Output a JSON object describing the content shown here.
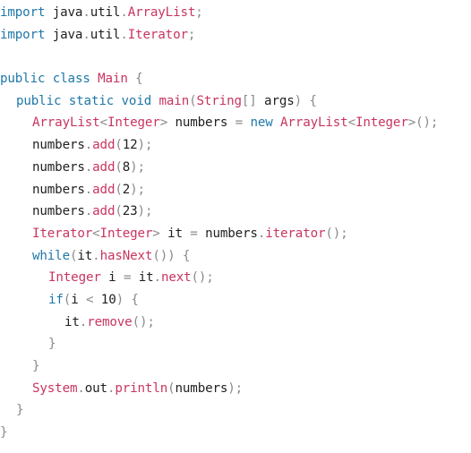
{
  "lines": [
    {
      "indent": 0,
      "tokens": [
        {
          "t": "import",
          "c": "kw"
        },
        {
          "t": " java",
          "c": "tx"
        },
        {
          "t": ".",
          "c": "pn"
        },
        {
          "t": "util",
          "c": "tx"
        },
        {
          "t": ".",
          "c": "pn"
        },
        {
          "t": "ArrayList",
          "c": "ty"
        },
        {
          "t": ";",
          "c": "pn"
        }
      ]
    },
    {
      "indent": 0,
      "tokens": [
        {
          "t": "import",
          "c": "kw"
        },
        {
          "t": " java",
          "c": "tx"
        },
        {
          "t": ".",
          "c": "pn"
        },
        {
          "t": "util",
          "c": "tx"
        },
        {
          "t": ".",
          "c": "pn"
        },
        {
          "t": "Iterator",
          "c": "ty"
        },
        {
          "t": ";",
          "c": "pn"
        }
      ]
    },
    {
      "indent": 0,
      "tokens": []
    },
    {
      "indent": 0,
      "tokens": [
        {
          "t": "public",
          "c": "kw"
        },
        {
          "t": " ",
          "c": "tx"
        },
        {
          "t": "class",
          "c": "kw"
        },
        {
          "t": " ",
          "c": "tx"
        },
        {
          "t": "Main",
          "c": "ty"
        },
        {
          "t": " {",
          "c": "pn"
        }
      ]
    },
    {
      "indent": 1,
      "tokens": [
        {
          "t": "public",
          "c": "kw"
        },
        {
          "t": " ",
          "c": "tx"
        },
        {
          "t": "static",
          "c": "kw"
        },
        {
          "t": " ",
          "c": "tx"
        },
        {
          "t": "void",
          "c": "kw"
        },
        {
          "t": " ",
          "c": "tx"
        },
        {
          "t": "main",
          "c": "ty"
        },
        {
          "t": "(",
          "c": "pn"
        },
        {
          "t": "String",
          "c": "ty"
        },
        {
          "t": "[]",
          "c": "pn"
        },
        {
          "t": " args",
          "c": "tx"
        },
        {
          "t": ") {",
          "c": "pn"
        }
      ]
    },
    {
      "indent": 2,
      "tokens": [
        {
          "t": "ArrayList",
          "c": "ty"
        },
        {
          "t": "<",
          "c": "pn"
        },
        {
          "t": "Integer",
          "c": "ty"
        },
        {
          "t": ">",
          "c": "pn"
        },
        {
          "t": " numbers ",
          "c": "tx"
        },
        {
          "t": "=",
          "c": "pn"
        },
        {
          "t": " ",
          "c": "tx"
        },
        {
          "t": "new",
          "c": "kw"
        },
        {
          "t": " ",
          "c": "tx"
        },
        {
          "t": "ArrayList",
          "c": "ty"
        },
        {
          "t": "<",
          "c": "pn"
        },
        {
          "t": "Integer",
          "c": "ty"
        },
        {
          "t": ">();",
          "c": "pn"
        }
      ]
    },
    {
      "indent": 2,
      "tokens": [
        {
          "t": "numbers",
          "c": "tx"
        },
        {
          "t": ".",
          "c": "pn"
        },
        {
          "t": "add",
          "c": "ty"
        },
        {
          "t": "(",
          "c": "pn"
        },
        {
          "t": "12",
          "c": "tx"
        },
        {
          "t": ");",
          "c": "pn"
        }
      ]
    },
    {
      "indent": 2,
      "tokens": [
        {
          "t": "numbers",
          "c": "tx"
        },
        {
          "t": ".",
          "c": "pn"
        },
        {
          "t": "add",
          "c": "ty"
        },
        {
          "t": "(",
          "c": "pn"
        },
        {
          "t": "8",
          "c": "tx"
        },
        {
          "t": ");",
          "c": "pn"
        }
      ]
    },
    {
      "indent": 2,
      "tokens": [
        {
          "t": "numbers",
          "c": "tx"
        },
        {
          "t": ".",
          "c": "pn"
        },
        {
          "t": "add",
          "c": "ty"
        },
        {
          "t": "(",
          "c": "pn"
        },
        {
          "t": "2",
          "c": "tx"
        },
        {
          "t": ");",
          "c": "pn"
        }
      ]
    },
    {
      "indent": 2,
      "tokens": [
        {
          "t": "numbers",
          "c": "tx"
        },
        {
          "t": ".",
          "c": "pn"
        },
        {
          "t": "add",
          "c": "ty"
        },
        {
          "t": "(",
          "c": "pn"
        },
        {
          "t": "23",
          "c": "tx"
        },
        {
          "t": ");",
          "c": "pn"
        }
      ]
    },
    {
      "indent": 2,
      "tokens": [
        {
          "t": "Iterator",
          "c": "ty"
        },
        {
          "t": "<",
          "c": "pn"
        },
        {
          "t": "Integer",
          "c": "ty"
        },
        {
          "t": ">",
          "c": "pn"
        },
        {
          "t": " it ",
          "c": "tx"
        },
        {
          "t": "=",
          "c": "pn"
        },
        {
          "t": " numbers",
          "c": "tx"
        },
        {
          "t": ".",
          "c": "pn"
        },
        {
          "t": "iterator",
          "c": "ty"
        },
        {
          "t": "();",
          "c": "pn"
        }
      ]
    },
    {
      "indent": 2,
      "tokens": [
        {
          "t": "while",
          "c": "kw"
        },
        {
          "t": "(",
          "c": "pn"
        },
        {
          "t": "it",
          "c": "tx"
        },
        {
          "t": ".",
          "c": "pn"
        },
        {
          "t": "hasNext",
          "c": "ty"
        },
        {
          "t": "()) {",
          "c": "pn"
        }
      ]
    },
    {
      "indent": 3,
      "tokens": [
        {
          "t": "Integer",
          "c": "ty"
        },
        {
          "t": " i ",
          "c": "tx"
        },
        {
          "t": "=",
          "c": "pn"
        },
        {
          "t": " it",
          "c": "tx"
        },
        {
          "t": ".",
          "c": "pn"
        },
        {
          "t": "next",
          "c": "ty"
        },
        {
          "t": "();",
          "c": "pn"
        }
      ]
    },
    {
      "indent": 3,
      "tokens": [
        {
          "t": "if",
          "c": "kw"
        },
        {
          "t": "(",
          "c": "pn"
        },
        {
          "t": "i ",
          "c": "tx"
        },
        {
          "t": "<",
          "c": "pn"
        },
        {
          "t": " 10",
          "c": "tx"
        },
        {
          "t": ") {",
          "c": "pn"
        }
      ]
    },
    {
      "indent": 4,
      "tokens": [
        {
          "t": "it",
          "c": "tx"
        },
        {
          "t": ".",
          "c": "pn"
        },
        {
          "t": "remove",
          "c": "ty"
        },
        {
          "t": "();",
          "c": "pn"
        }
      ]
    },
    {
      "indent": 3,
      "tokens": [
        {
          "t": "}",
          "c": "pn"
        }
      ]
    },
    {
      "indent": 2,
      "tokens": [
        {
          "t": "}",
          "c": "pn"
        }
      ]
    },
    {
      "indent": 2,
      "tokens": [
        {
          "t": "System",
          "c": "ty"
        },
        {
          "t": ".",
          "c": "pn"
        },
        {
          "t": "out",
          "c": "tx"
        },
        {
          "t": ".",
          "c": "pn"
        },
        {
          "t": "println",
          "c": "ty"
        },
        {
          "t": "(",
          "c": "pn"
        },
        {
          "t": "numbers",
          "c": "tx"
        },
        {
          "t": ");",
          "c": "pn"
        }
      ]
    },
    {
      "indent": 1,
      "tokens": [
        {
          "t": "}",
          "c": "pn"
        }
      ]
    },
    {
      "indent": 0,
      "tokens": [
        {
          "t": "}",
          "c": "pn"
        }
      ]
    }
  ]
}
